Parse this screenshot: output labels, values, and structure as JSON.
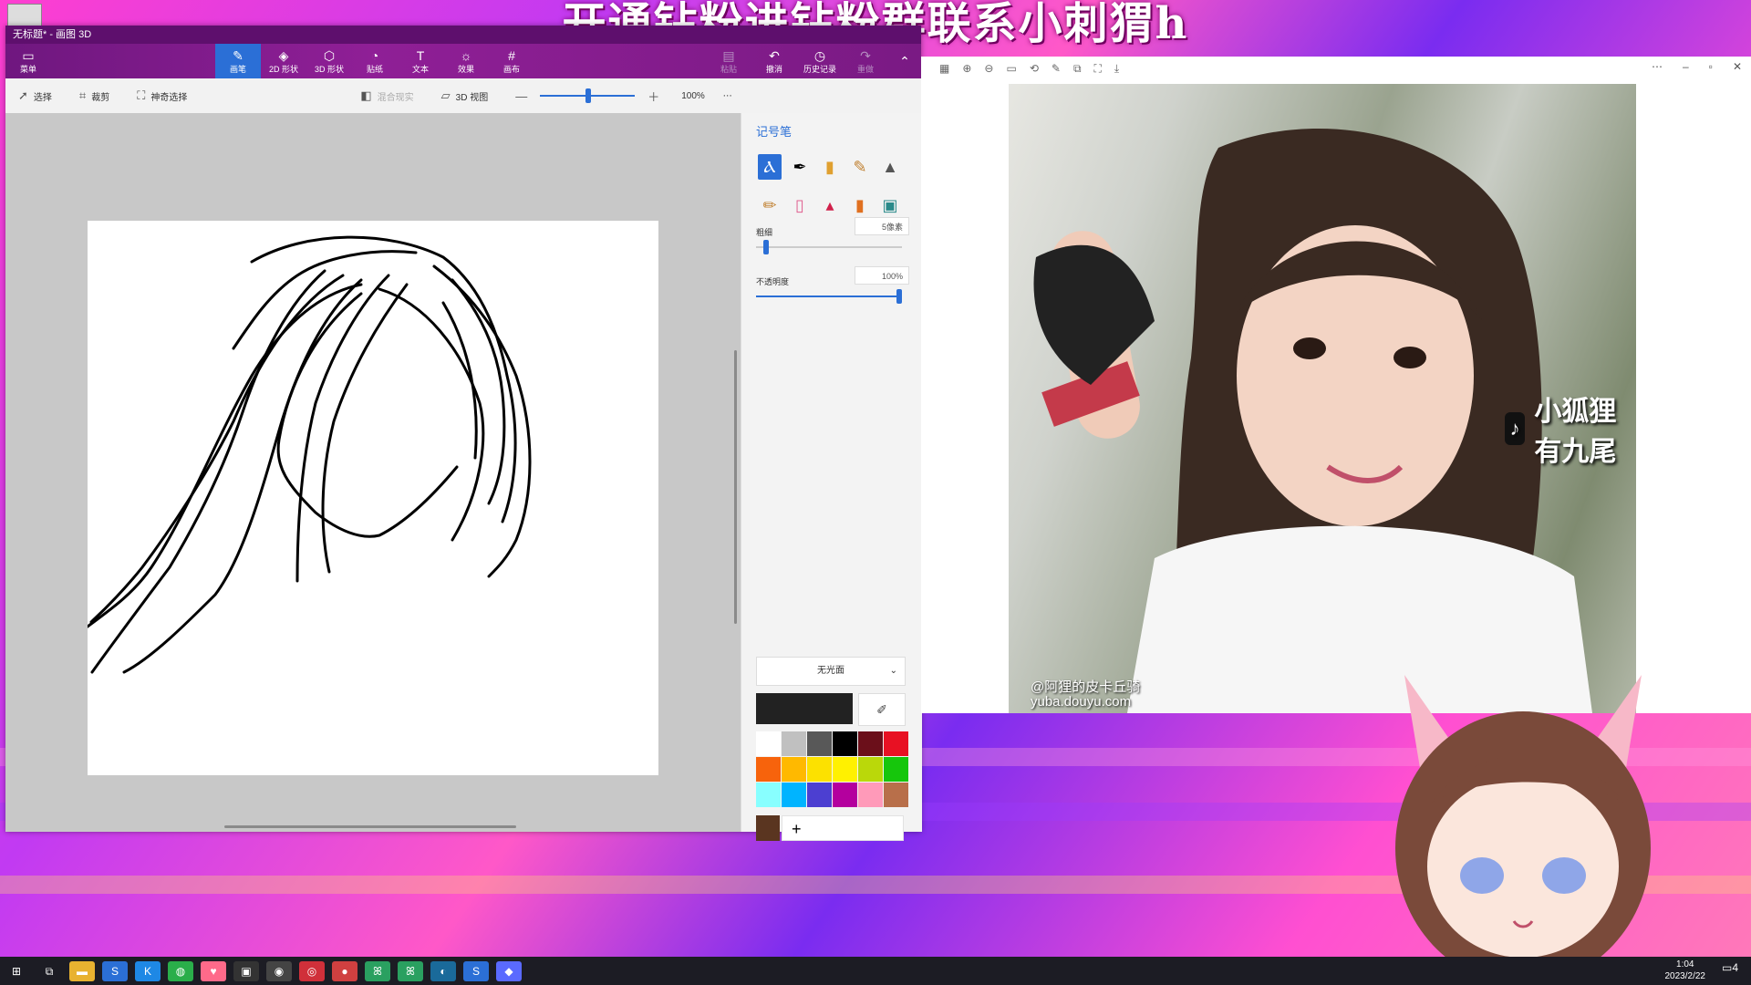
{
  "banner": {
    "text": "开通钻粉进钻粉群联系小刺猬h"
  },
  "paint": {
    "title": "无标题* - 画图 3D",
    "toolbar": [
      {
        "label": "菜单",
        "icon": "▭",
        "state": "normal"
      },
      {
        "label": "",
        "icon": "",
        "state": "spacer"
      },
      {
        "label": "",
        "icon": "",
        "state": "spacer"
      },
      {
        "label": "画笔",
        "icon": "✎",
        "state": "active"
      },
      {
        "label": "2D 形状",
        "icon": "◈",
        "state": "normal"
      },
      {
        "label": "3D 形状",
        "icon": "⬡",
        "state": "normal"
      },
      {
        "label": "贴纸",
        "icon": "◔",
        "state": "normal"
      },
      {
        "label": "文本",
        "icon": "T",
        "state": "normal"
      },
      {
        "label": "效果",
        "icon": "☼",
        "state": "normal"
      },
      {
        "label": "画布",
        "icon": "#",
        "state": "normal"
      }
    ],
    "toolbar_right": [
      {
        "label": "粘贴",
        "icon": "📋",
        "state": "dim"
      },
      {
        "label": "撤消",
        "icon": "↶",
        "state": "normal"
      },
      {
        "label": "历史记录",
        "icon": "◷",
        "state": "normal"
      },
      {
        "label": "重做",
        "icon": "↷",
        "state": "dim"
      }
    ],
    "subbar": {
      "select": "选择",
      "crop": "裁剪",
      "magic": "神奇选择",
      "mixed": "混合现实",
      "view3d": "3D 视图",
      "zoom": "100%",
      "more": "⋯"
    },
    "panel": {
      "title": "记号笔",
      "thickness_label": "粗细",
      "thickness_value": "5像素",
      "thickness_pct": 0.05,
      "opacity_label": "不透明度",
      "opacity_value": "100%",
      "opacity_pct": 1.0,
      "finish": "无光面",
      "current_color": "#222222",
      "custom_color": "#5a3520",
      "palette": [
        "#ffffff",
        "#c0c0c0",
        "#585858",
        "#000000",
        "#6b0f1a",
        "#e81123",
        "#f7630c",
        "#ffb900",
        "#fce100",
        "#fff100",
        "#bad80a",
        "#16c60c",
        "#88ffff",
        "#00b4ff",
        "#4c3fd1",
        "#b4009e",
        "#ff9ab9",
        "#b86f4a"
      ]
    }
  },
  "viewer": {
    "watermark_logo": "小狐狸有九尾",
    "watermark_line1": "@阿狸的皮卡丘骑",
    "watermark_line2": "yuba.douyu.com"
  },
  "taskbar": {
    "time": "1:04",
    "date": "2023/2/22",
    "notify": "4"
  }
}
